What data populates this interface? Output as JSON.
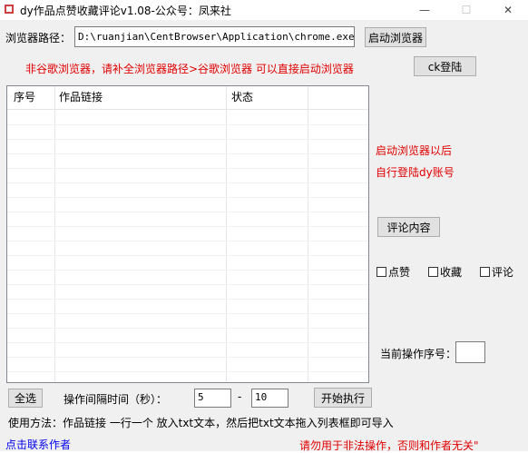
{
  "window": {
    "title": "dy作品点赞收藏评论v1.08-公众号：凤来社",
    "minimize_glyph": "—",
    "maximize_glyph": "☐",
    "close_glyph": "✕"
  },
  "browser_path": {
    "label": "浏览器路径：",
    "value": "D:\\ruanjian\\CentBrowser\\Application\\chrome.exe",
    "launch_button": "启动浏览器"
  },
  "notice_non_chrome": "非谷歌浏览器，请补全浏览器路径>谷歌浏览器 可以直接启动浏览器",
  "login_button": "ck登陆",
  "list": {
    "columns": [
      "序号",
      "作品链接",
      "状态"
    ]
  },
  "hint": {
    "line1": "启动浏览器以后",
    "line2": "自行登陆dy账号"
  },
  "comment_button": "评论内容",
  "options": {
    "like": "点赞",
    "collect": "收藏",
    "comment": "评论"
  },
  "current_index": {
    "label": "当前操作序号：",
    "value": ""
  },
  "controls": {
    "select_all": "全选",
    "interval_label": "操作间隔时间（秒）：",
    "min": "5",
    "dash": "-",
    "max": "10",
    "start": "开始执行"
  },
  "usage": "使用方法：作品链接 一行一个 放入txt文本，然后把txt文本拖入列表框即可导入",
  "contact_link": "点击联系作者",
  "disclaimer": "请勿用于非法操作，否则和作者无关\""
}
